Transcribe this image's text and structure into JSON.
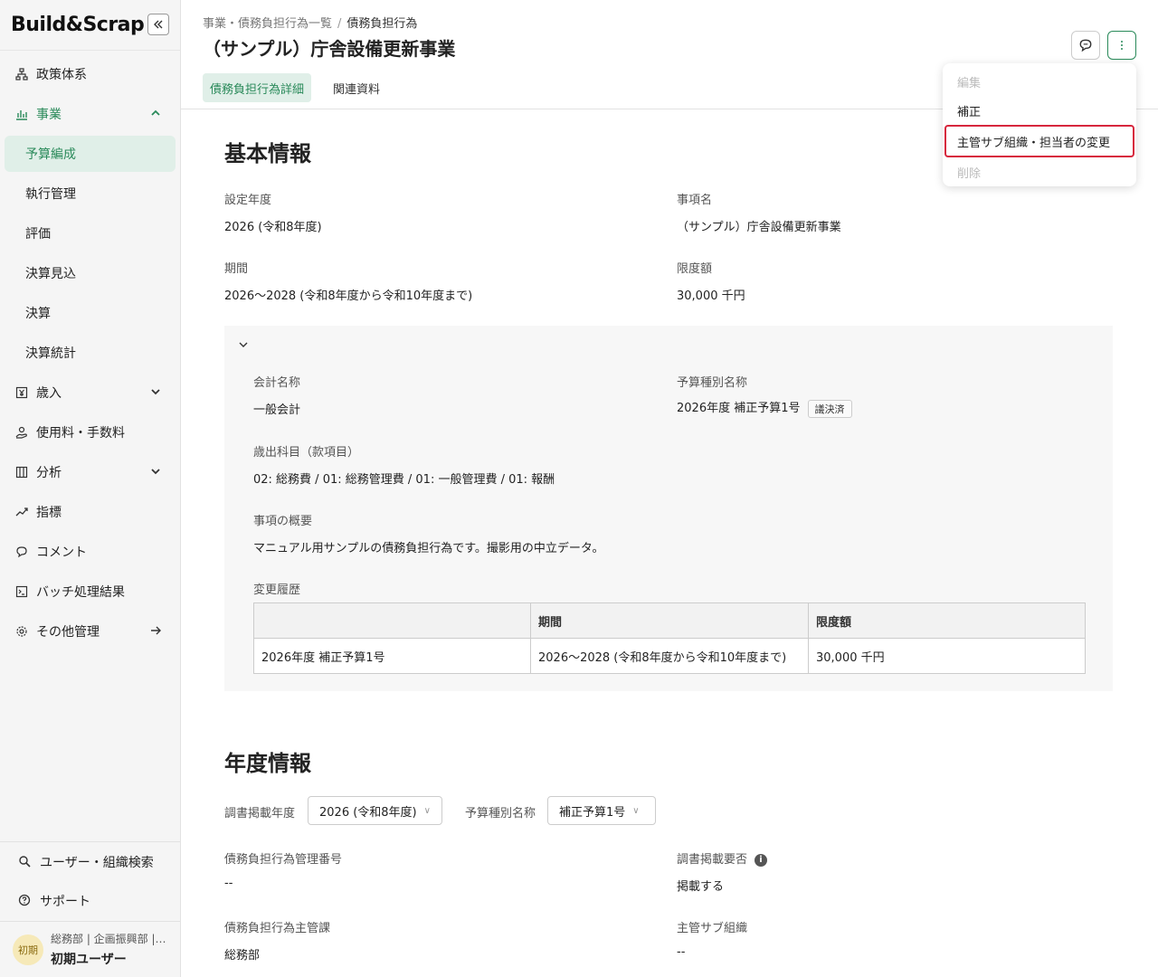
{
  "app": {
    "logo": "Build&Scrap"
  },
  "sidebar": {
    "items": [
      {
        "label": "政策体系",
        "icon": "hierarchy-icon"
      },
      {
        "label": "事業",
        "icon": "bar-chart-icon"
      },
      {
        "label": "歳入",
        "icon": "yen-icon"
      },
      {
        "label": "使用料・手数料",
        "icon": "hand-coin-icon"
      },
      {
        "label": "分析",
        "icon": "columns-icon"
      },
      {
        "label": "指標",
        "icon": "trend-icon"
      },
      {
        "label": "コメント",
        "icon": "comment-icon"
      },
      {
        "label": "バッチ処理結果",
        "icon": "terminal-icon"
      },
      {
        "label": "その他管理",
        "icon": "gear-icon"
      }
    ],
    "sub_items": [
      "予算編成",
      "執行管理",
      "評価",
      "決算見込",
      "決算",
      "決算統計"
    ],
    "bottom": {
      "search": "ユーザー・組織検索",
      "support": "サポート"
    },
    "user": {
      "avatar": "初期",
      "org": "総務部 | 企画振興部 | …",
      "name": "初期ユーザー"
    }
  },
  "header": {
    "breadcrumb": {
      "parent": "事業・債務負担行為一覧",
      "current": "債務負担行為"
    },
    "title": "（サンプル）庁舎設備更新事業",
    "tabs": [
      "債務負担行為詳細",
      "関連資料"
    ]
  },
  "menu": {
    "items": [
      {
        "label": "編集",
        "disabled": true
      },
      {
        "label": "補正",
        "disabled": false
      },
      {
        "label": "主管サブ組織・担当者の変更",
        "disabled": false
      },
      {
        "label": "削除",
        "disabled": true
      }
    ]
  },
  "basic": {
    "section_title": "基本情報",
    "year_label": "設定年度",
    "year_value": "2026 (令和8年度)",
    "name_label": "事項名",
    "name_value": "（サンプル）庁舎設備更新事業",
    "period_label": "期間",
    "period_value": "2026〜2028 (令和8年度から令和10年度まで)",
    "limit_label": "限度額",
    "limit_value": "30,000 千円",
    "account_label": "会計名称",
    "account_value": "一般会計",
    "budget_type_label": "予算種別名称",
    "budget_type_value": "2026年度 補正予算1号",
    "budget_type_badge": "議決済",
    "subject_label": "歳出科目（款項目）",
    "subject_value": "02: 総務費 / 01: 総務管理費 / 01: 一般管理費 / 01: 報酬",
    "summary_label": "事項の概要",
    "summary_value": "マニュアル用サンプルの債務負担行為です。撮影用の中立データ。",
    "history_label": "変更履歴",
    "history": {
      "headers": [
        "",
        "期間",
        "限度額"
      ],
      "rows": [
        [
          "2026年度 補正予算1号",
          "2026〜2028 (令和8年度から令和10年度まで)",
          "30,000 千円"
        ]
      ]
    }
  },
  "annual": {
    "section_title": "年度情報",
    "year_select_label": "調書掲載年度",
    "year_select_value": "2026 (令和8年度)",
    "type_select_label": "予算種別名称",
    "type_select_value": "補正予算1号",
    "mgmt_no_label": "債務負担行為管理番号",
    "mgmt_no_value": "--",
    "publish_label": "調書掲載要否",
    "publish_value": "掲載する",
    "dept_label": "債務負担行為主管課",
    "dept_value": "総務部",
    "subdept_label": "主管サブ組織",
    "subdept_value": "--"
  }
}
